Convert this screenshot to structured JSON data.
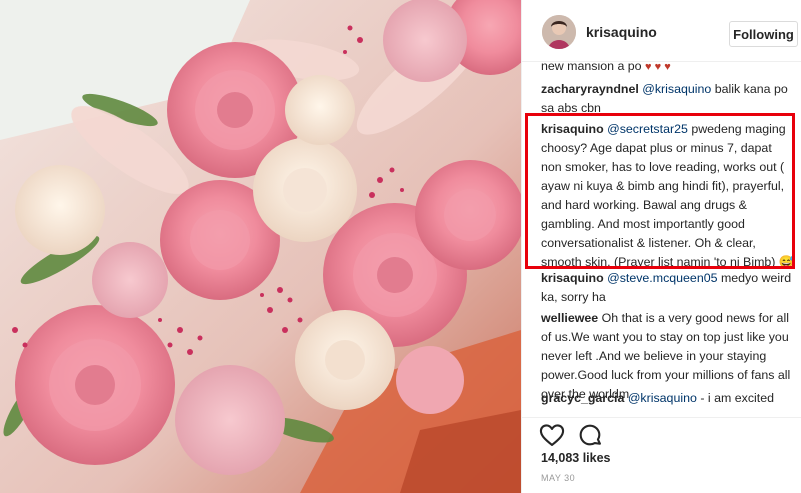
{
  "post": {
    "username": "krisaquino",
    "follow_label": "Following",
    "likes": "14,083 likes",
    "date": "MAY 30"
  },
  "comments": [
    {
      "user": "",
      "text": "new mansion a po",
      "hearts": "♥ ♥ ♥"
    },
    {
      "user": "zacharyrayndnel",
      "mention": "@krisaquino",
      "text": " balik kana po sa abs cbn"
    },
    {
      "user": "krisaquino",
      "mention": "@secretstar25",
      "text": " pwedeng maging choosy? Age dapat plus or minus 7, dapat non smoker, has to love reading, works out ( ayaw ni kuya & bimb ang hindi fit), prayerful, and hard working. Bawal ang drugs & gambling. And most importantly good conversationalist & listener. Oh & clear, smooth skin. (Prayer list namin 'to ni Bimb)",
      "emoji": "😅"
    },
    {
      "user": "krisaquino",
      "mention": "@steve.mcqueen05",
      "text": " medyo weird ka, sorry ha"
    },
    {
      "user": "welliewee",
      "text": " Oh that is a very good news for all of us.We want you to stay on top just like you never left .And we believe in your staying power.Good luck from your millions of fans all over the worldm"
    },
    {
      "user": "gracyc_garcia",
      "mention": "@krisaquino",
      "text": " - i am excited"
    }
  ],
  "icons": {
    "like": "heart-icon",
    "comment": "comment-icon"
  },
  "colors": {
    "highlight": "#e8000b",
    "mention": "#003569",
    "heart": "#c0392b"
  }
}
